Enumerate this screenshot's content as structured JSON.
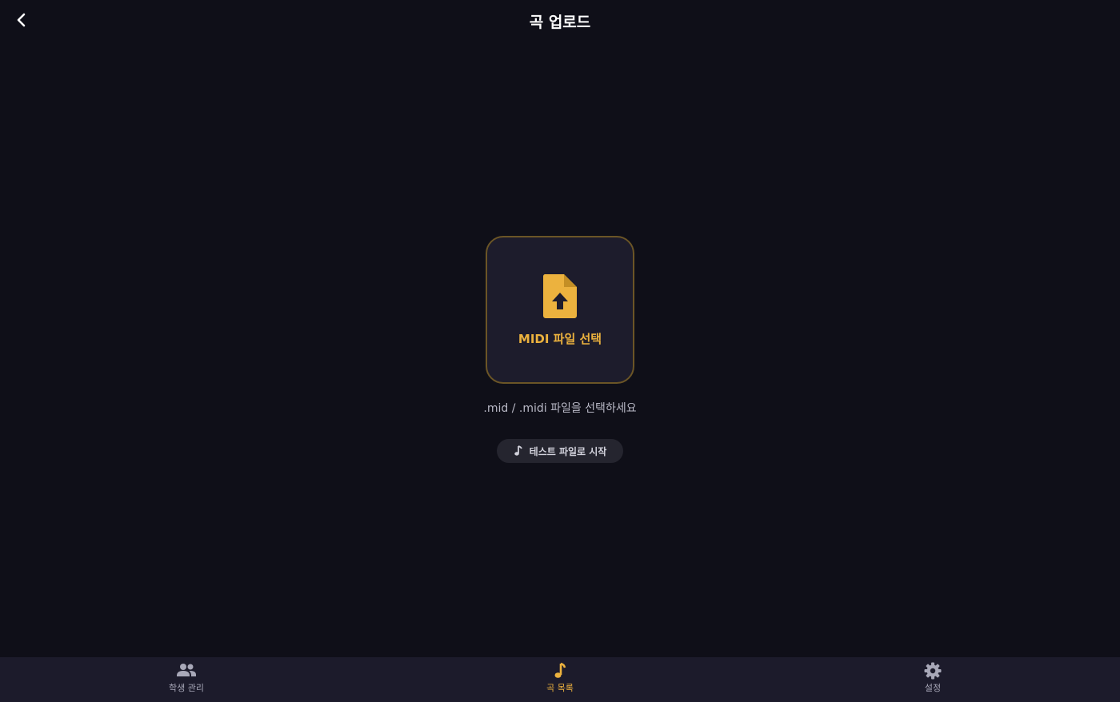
{
  "header": {
    "title": "곡 업로드",
    "back_icon": "chevron-left-icon"
  },
  "upload": {
    "icon": "file-upload-icon",
    "label": "MIDI 파일 선택",
    "hint": ".mid / .midi 파일을 선택하세요"
  },
  "test_button": {
    "icon": "music-note-icon",
    "label": "테스트 파일로 시작"
  },
  "nav": {
    "items": [
      {
        "label": "학생 관리",
        "icon": "people-icon",
        "active": false
      },
      {
        "label": "곡 목록",
        "icon": "music-note-icon",
        "active": true
      },
      {
        "label": "설정",
        "icon": "gear-icon",
        "active": false
      }
    ]
  },
  "colors": {
    "background": "#0f0f18",
    "accent": "#ecb23e",
    "nav_background": "#1c1b2b",
    "card_background": "#1d1c2c"
  }
}
